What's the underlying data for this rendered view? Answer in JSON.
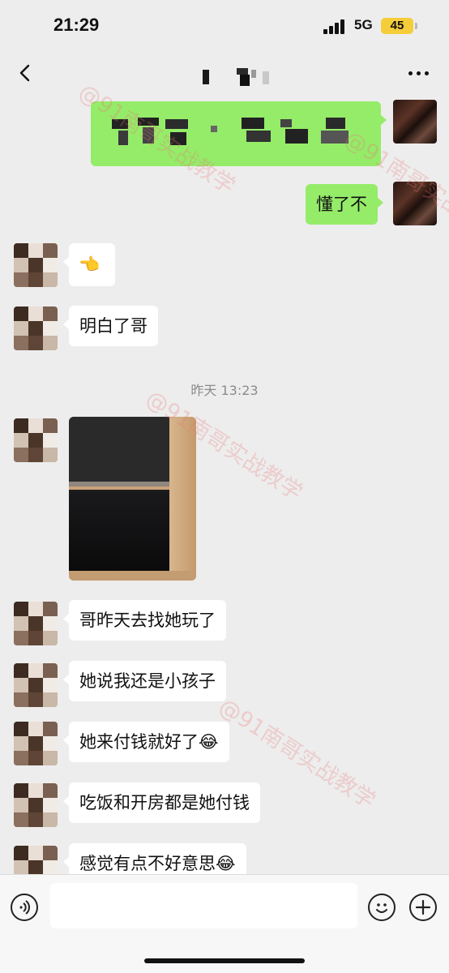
{
  "status_bar": {
    "time": "21:29",
    "network": "5G",
    "battery": "45"
  },
  "nav": {
    "back_icon": "chevron-left-icon",
    "more_icon": "more-dots-icon"
  },
  "messages": [
    {
      "from": "me",
      "type": "text",
      "content_pixelated": true
    },
    {
      "from": "me",
      "type": "text",
      "text": "懂了不"
    },
    {
      "from": "peer",
      "type": "emoji",
      "emoji": "👈"
    },
    {
      "from": "peer",
      "type": "text",
      "text": "明白了哥"
    },
    {
      "type": "timestamp",
      "text": "昨天 13:23"
    },
    {
      "from": "peer",
      "type": "image"
    },
    {
      "from": "peer",
      "type": "text",
      "text": "哥昨天去找她玩了"
    },
    {
      "from": "peer",
      "type": "text",
      "text": "她说我还是小孩子"
    },
    {
      "from": "peer",
      "type": "text",
      "text": "她来付钱就好了😂"
    },
    {
      "from": "peer",
      "type": "text",
      "text": "吃饭和开房都是她付钱"
    },
    {
      "from": "peer",
      "type": "text",
      "text": "感觉有点不好意思😂"
    }
  ],
  "input_bar": {
    "voice_icon": "voice-icon",
    "emoji_icon": "smiley-icon",
    "add_icon": "plus-icon",
    "input_value": ""
  },
  "watermark": {
    "text": "@91南哥实战教学"
  },
  "colors": {
    "outgoing_bubble": "#95ec69",
    "incoming_bubble": "#ffffff",
    "background": "#ededed",
    "battery": "#f5cd3a"
  }
}
